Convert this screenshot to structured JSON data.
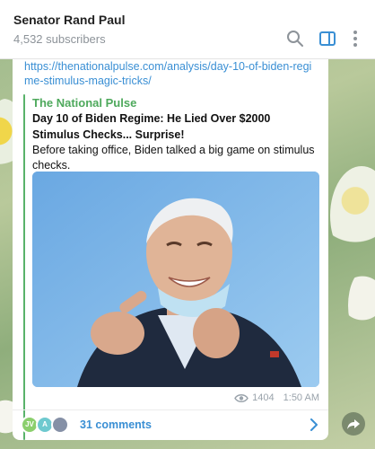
{
  "header": {
    "channel_name": "Senator Rand Paul",
    "subscribers": "4,532 subscribers",
    "icons": [
      "search-icon",
      "sidebar-toggle-icon",
      "more-vertical-icon"
    ]
  },
  "post": {
    "link_text": "https://thenationalpulse.com/analysis/day-10-of-biden-regime-stimulus-magic-tricks/",
    "preview": {
      "site_name": "The National Pulse",
      "title": "Day 10 of Biden Regime: He Lied Over $2000 Stimulus Checks... Surprise!",
      "description": "Before taking office, Biden talked a big game on stimulus checks.",
      "accent_color": "#59b26a"
    },
    "views": "1404",
    "time": "1:50 AM",
    "comments": {
      "label": "31 comments",
      "avatars": [
        "JV",
        "A",
        ""
      ]
    }
  },
  "colors": {
    "link": "#3a8fd4",
    "site_name": "#4ea95c",
    "meta": "#9aa3ab"
  }
}
